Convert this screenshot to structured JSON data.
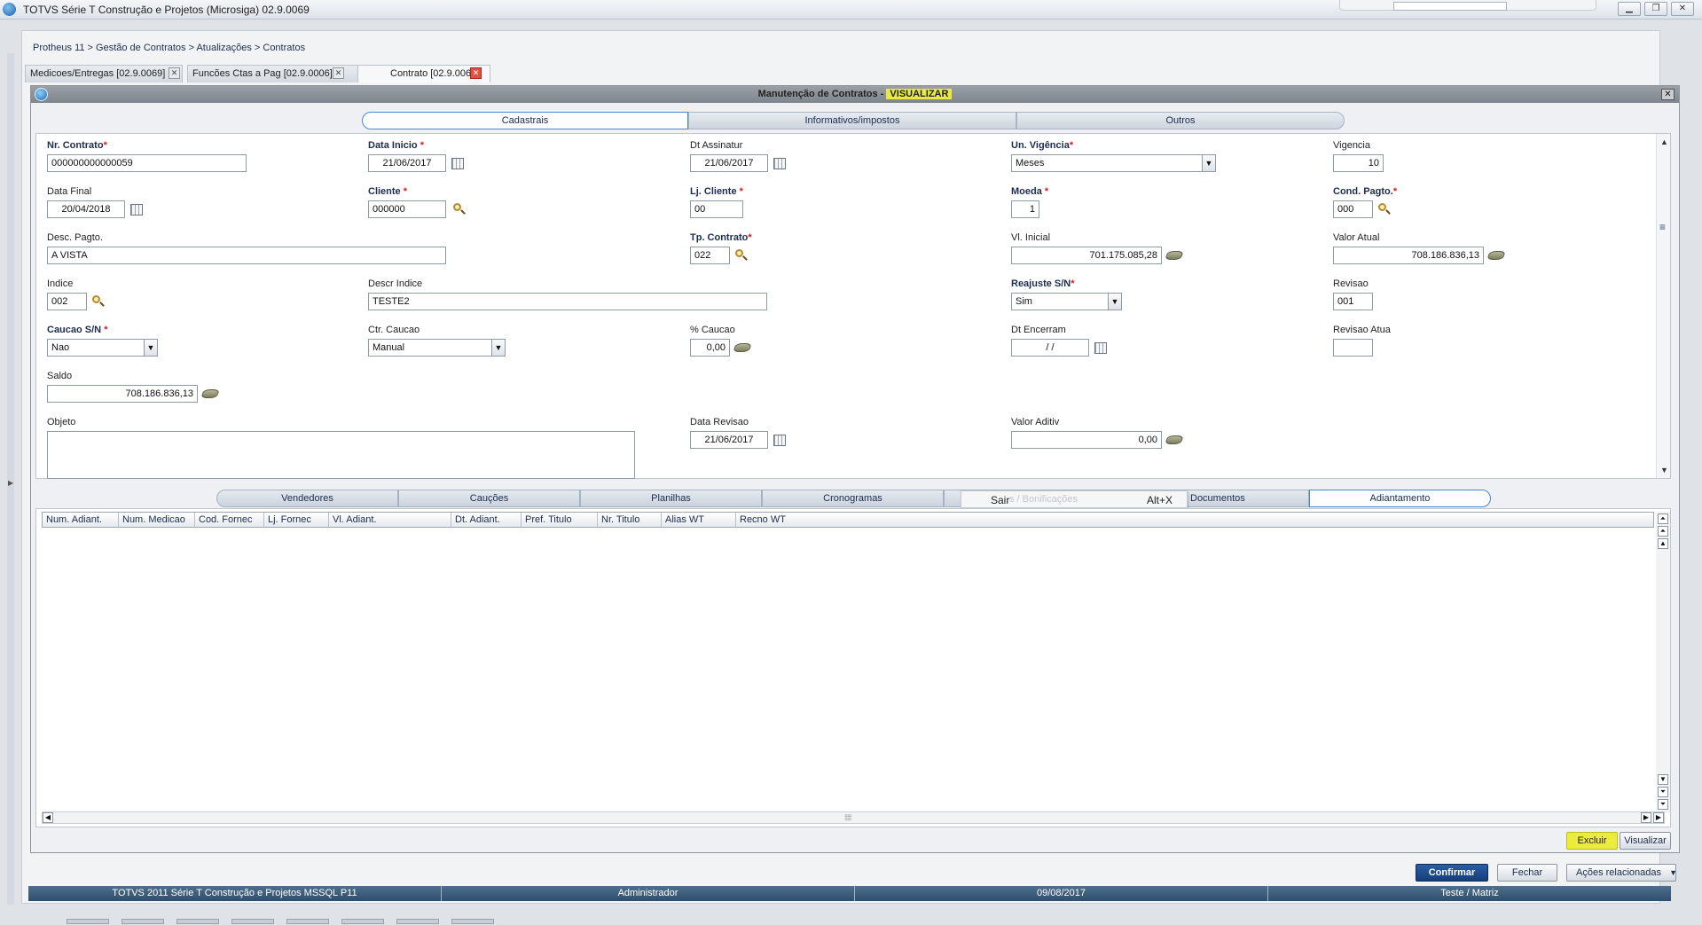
{
  "window": {
    "title": "TOTVS Série T Construção e Projetos (Microsiga) 02.9.0069",
    "controls": [
      "▁",
      "❐",
      "✕"
    ]
  },
  "breadcrumb": "Protheus 11 > Gestão de Contratos > Atualizações > Contratos",
  "doc_tabs": [
    {
      "label": "Medicoes/Entregas [02.9.0069]"
    },
    {
      "label": "Funcões Ctas a Pag [02.9.0006]"
    },
    {
      "label": "Contrato [02.9.0069]"
    }
  ],
  "dialog": {
    "title": "Manutenção de Contratos - ",
    "mode": "VISUALIZAR",
    "close": "✕"
  },
  "folders": [
    "Cadastrais",
    "Informativos/impostos",
    "Outros"
  ],
  "fields": {
    "nr_contrato": {
      "label": "Nr. Contrato",
      "value": "000000000000059"
    },
    "data_inicio": {
      "label": "Data Inicio ",
      "value": "21/06/2017"
    },
    "dt_assinatur": {
      "label": "Dt Assinatur",
      "value": "21/06/2017"
    },
    "un_vigencia": {
      "label": "Un. Vigência",
      "value": "Meses"
    },
    "vigencia": {
      "label": "Vigencia",
      "value": "10"
    },
    "data_final": {
      "label": "Data Final",
      "value": "20/04/2018"
    },
    "cliente": {
      "label": "Cliente ",
      "value": "000000"
    },
    "lj_cliente": {
      "label": "Lj. Cliente ",
      "value": "00"
    },
    "moeda": {
      "label": "Moeda ",
      "value": "1"
    },
    "cond_pagto": {
      "label": "Cond. Pagto.",
      "value": "000"
    },
    "desc_pagto": {
      "label": "Desc. Pagto.",
      "value": "A VISTA"
    },
    "tp_contrato": {
      "label": "Tp. Contrato",
      "value": "022"
    },
    "vl_inicial": {
      "label": "Vl. Inicial",
      "value": "701.175.085,28"
    },
    "valor_atual": {
      "label": "Valor Atual",
      "value": "708.186.836,13"
    },
    "indice": {
      "label": "Indice",
      "value": "002"
    },
    "descr_indice": {
      "label": "Descr Indice",
      "value": "TESTE2"
    },
    "reajuste": {
      "label": "Reajuste S/N",
      "value": "Sim"
    },
    "revisao": {
      "label": "Revisao",
      "value": "001"
    },
    "caucao": {
      "label": "Caucao S/N ",
      "value": "Nao"
    },
    "ctr_caucao": {
      "label": "Ctr. Caucao",
      "value": "Manual"
    },
    "pct_caucao": {
      "label": "% Caucao",
      "value": "0,00"
    },
    "dt_encerram": {
      "label": "Dt Encerram",
      "value": " /  / "
    },
    "revisao_atua": {
      "label": "Revisao Atua",
      "value": ""
    },
    "saldo": {
      "label": "Saldo",
      "value": "708.186.836,13"
    },
    "objeto": {
      "label": "Objeto",
      "value": ""
    },
    "data_revisao": {
      "label": "Data Revisao",
      "value": "21/06/2017"
    },
    "valor_aditiv": {
      "label": "Valor Aditiv",
      "value": "0,00"
    }
  },
  "required_mark": "*",
  "sub_folders": [
    "Vendedores",
    "Cauções",
    "Planilhas",
    "Cronogramas",
    "",
    "Documentos",
    "Adiantamento"
  ],
  "context_popup": {
    "action": "Sair",
    "ghost": "s / Bonificações",
    "shortcut": "Alt+X"
  },
  "grid_columns": [
    "Num. Adiant.",
    "Num. Medicao",
    "Cod. Fornec",
    "Lj. Fornec",
    "Vl. Adiant.",
    "Dt. Adiant.",
    "Pref. Titulo",
    "Nr. Titulo",
    "Alias WT",
    "Recno WT"
  ],
  "grid_buttons": {
    "excluir": "Excluir",
    "visualizar": "Visualizar"
  },
  "footer_buttons": {
    "confirmar": "Confirmar",
    "fechar": "Fechar",
    "acoes": "Ações relacionadas"
  },
  "status_bar": [
    "TOTVS 2011 Série T Construção e Projetos MSSQL P11",
    "Administrador",
    "09/08/2017",
    "Teste / Matriz"
  ],
  "colors": {
    "highlight": "#e9e944",
    "primary_button": "#1f4a8a",
    "status_bar": "#3a5a7a",
    "required": "#d02020"
  },
  "icons": {
    "calendar": "calendar-icon",
    "lookup": "magnifier-icon",
    "money": "money-icon"
  }
}
